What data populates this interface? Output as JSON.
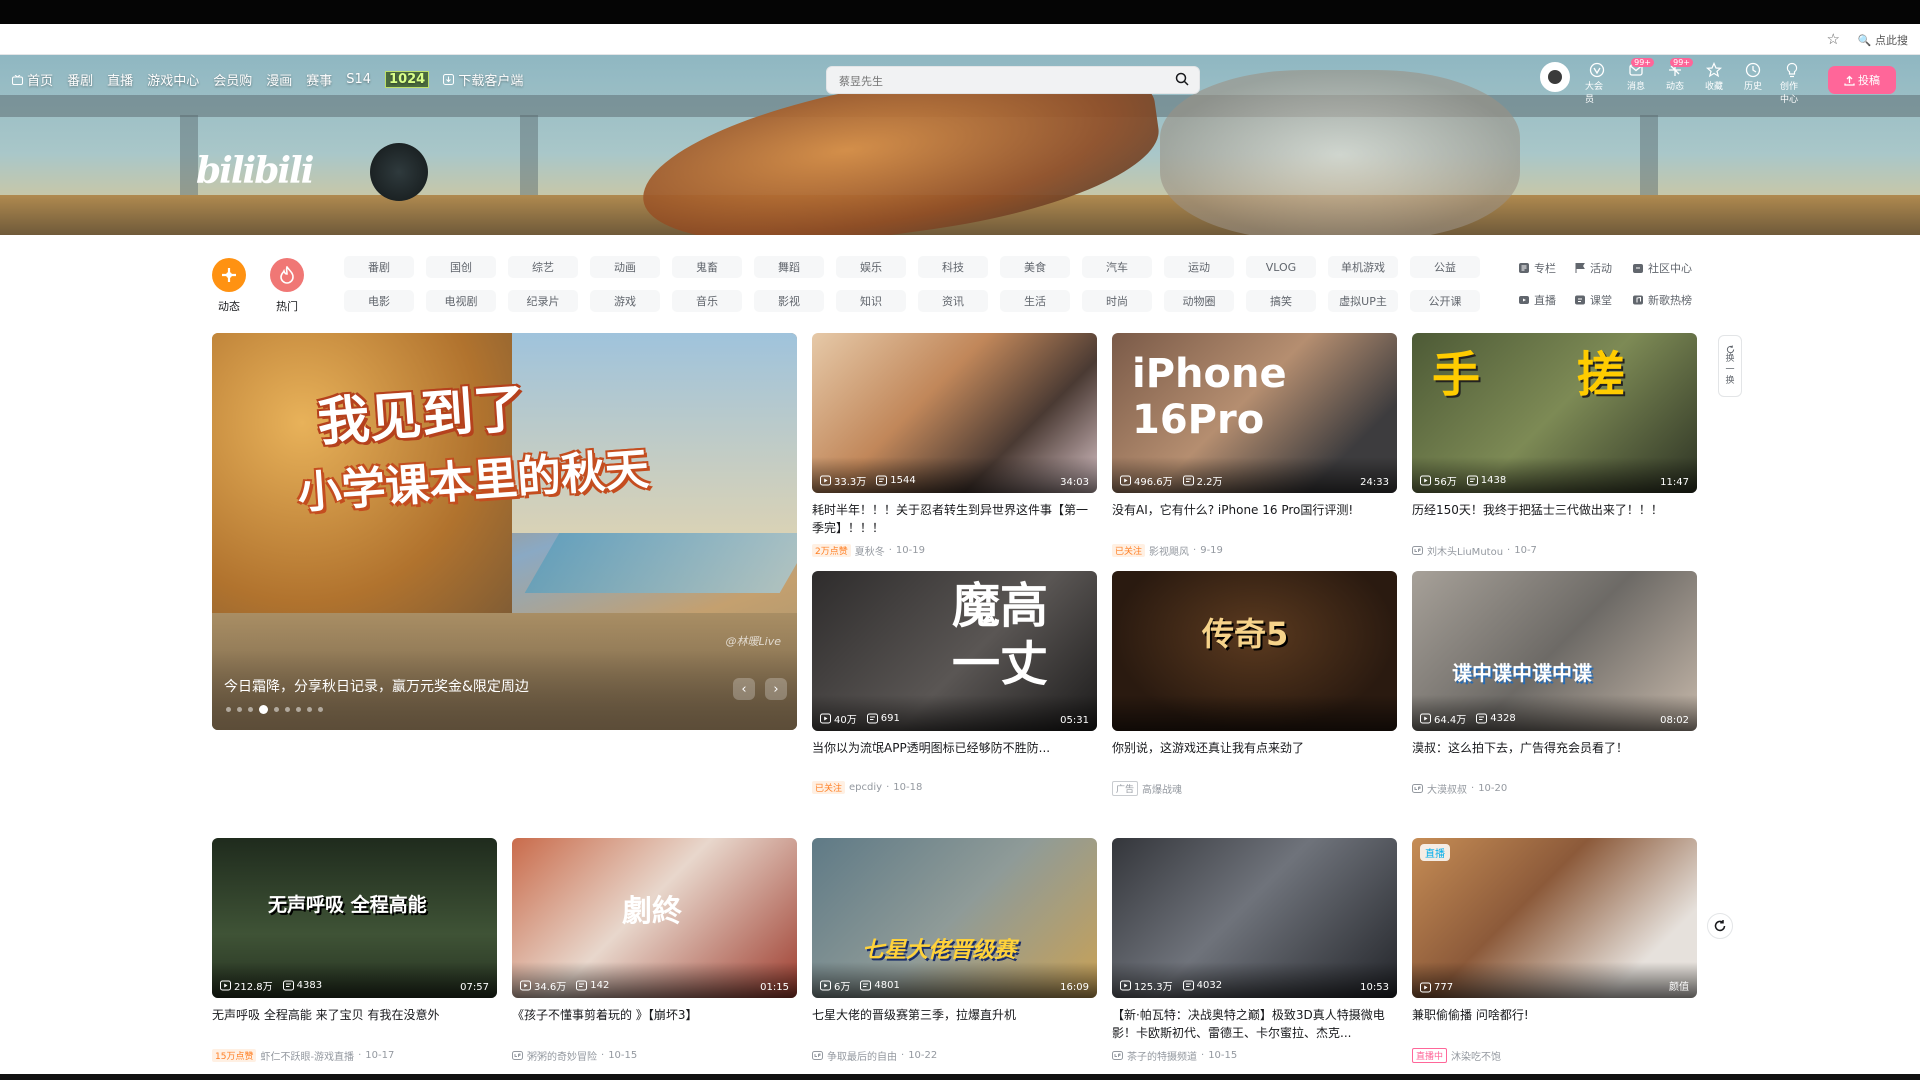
{
  "browser": {
    "search_hint": "点此搜"
  },
  "banner": {
    "logo": "bilibili"
  },
  "nav": {
    "left": [
      "首页",
      "番剧",
      "直播",
      "游戏中心",
      "会员购",
      "漫画",
      "赛事",
      "S14",
      "1024",
      "下载客户端"
    ],
    "search_placeholder": "蔡昱先生",
    "right": [
      {
        "label": "大会员",
        "icon": "vip-icon"
      },
      {
        "label": "消息",
        "icon": "message-icon",
        "badge": "99+"
      },
      {
        "label": "动态",
        "icon": "dynamic-icon",
        "badge": "99+"
      },
      {
        "label": "收藏",
        "icon": "star-icon"
      },
      {
        "label": "历史",
        "icon": "history-icon"
      },
      {
        "label": "创作中心",
        "icon": "bulb-icon"
      }
    ],
    "upload": "投稿"
  },
  "channels": {
    "dynamic": "动态",
    "hot": "热门",
    "categories": [
      "番剧",
      "国创",
      "综艺",
      "动画",
      "鬼畜",
      "舞蹈",
      "娱乐",
      "科技",
      "美食",
      "汽车",
      "运动",
      "VLOG",
      "单机游戏",
      "公益",
      "电影",
      "电视剧",
      "纪录片",
      "游戏",
      "音乐",
      "影视",
      "知识",
      "资讯",
      "生活",
      "时尚",
      "动物圈",
      "搞笑",
      "虚拟UP主",
      "公开课"
    ],
    "side": [
      "专栏",
      "活动",
      "社区中心",
      "直播",
      "课堂",
      "新歌热榜"
    ]
  },
  "carousel": {
    "title_line1": "我见到了",
    "title_line2": "小学课本里的秋天",
    "watermark": "@林暖Live",
    "caption": "今日霜降，分享秋日记录，赢万元奖金&限定周边",
    "prev": "‹",
    "next": "›"
  },
  "refresh_side": [
    "换",
    "一",
    "换"
  ],
  "videos": [
    {
      "views": "33.3万",
      "danmaku": "1544",
      "duration": "34:03",
      "title": "耗时半年！！！关于忍者转生到异世界这件事【第一季完】！！！",
      "tag": "2万点赞",
      "tag_style": "orange",
      "author": "夏秋冬",
      "date": "10-19",
      "thumb_text": ""
    },
    {
      "views": "496.6万",
      "danmaku": "2.2万",
      "duration": "24:33",
      "title": "没有AI，它有什么? iPhone 16 Pro国行评测!",
      "tag": "已关注",
      "tag_style": "orange",
      "author": "影视飓风",
      "date": "9-19",
      "thumb_text": "iPhone 16Pro"
    },
    {
      "views": "56万",
      "danmaku": "1438",
      "duration": "11:47",
      "title": "历经150天！我终于把猛士三代做出来了！！！",
      "tag": "",
      "tag_style": "",
      "author": "刘木头LiuMutou",
      "date": "10-7",
      "thumb_text": "手 搓"
    },
    {
      "views": "40万",
      "danmaku": "691",
      "duration": "05:31",
      "title": "当你以为流氓APP透明图标已经够防不胜防...",
      "tag": "已关注",
      "tag_style": "orange",
      "author": "epcdiy",
      "date": "10-18",
      "thumb_text": "魔高一丈"
    },
    {
      "views": "",
      "danmaku": "",
      "duration": "",
      "title": "你别说，这游戏还真让我有点来劲了",
      "tag": "广告",
      "tag_style": "gray",
      "author": "高爆战魂",
      "date": "",
      "thumb_text": "传奇5"
    },
    {
      "views": "64.4万",
      "danmaku": "4328",
      "duration": "08:02",
      "title": "漠叔：这么拍下去，广告得充会员看了！",
      "tag": "",
      "tag_style": "",
      "author": "大漠叔叔",
      "date": "10-20",
      "thumb_text": "谍中谍中谍中谍"
    },
    {
      "views": "212.8万",
      "danmaku": "4383",
      "duration": "07:57",
      "title": "无声呼吸 全程高能 来了宝贝 有我在没意外",
      "tag": "15万点赞",
      "tag_style": "orange",
      "author": "虾仁不跃眼-游戏直播",
      "date": "10-17",
      "thumb_text": "无声呼吸 全程高能"
    },
    {
      "views": "34.6万",
      "danmaku": "142",
      "duration": "01:15",
      "title": "《孩子不懂事剪着玩的 》【崩坏3】",
      "tag": "",
      "tag_style": "",
      "author": "粥粥的奇妙冒险",
      "date": "10-15",
      "thumb_text": "劇終"
    },
    {
      "views": "6万",
      "danmaku": "4801",
      "duration": "16:09",
      "title": "七星大佬的晋级赛第三季，拉爆直升机",
      "tag": "",
      "tag_style": "",
      "author": "争取最后的自由",
      "date": "10-22",
      "thumb_text": "七星大佬晋级赛"
    },
    {
      "views": "125.3万",
      "danmaku": "4032",
      "duration": "10:53",
      "title": "【新·帕瓦特：决战奥特之巅】极致3D真人特摄微电影！卡欧斯初代、雷德王、卡尔蜜拉、杰克...",
      "tag": "",
      "tag_style": "",
      "author": "茶子的特摄频道",
      "date": "10-15",
      "thumb_text": ""
    },
    {
      "views": "777",
      "danmaku": "",
      "duration": "颜值",
      "title": "兼职偷偷播 问啥都行!",
      "tag": "直播中",
      "tag_style": "red",
      "author": "沐染吃不饱",
      "date": "",
      "thumb_text": "",
      "live": "直播"
    }
  ]
}
